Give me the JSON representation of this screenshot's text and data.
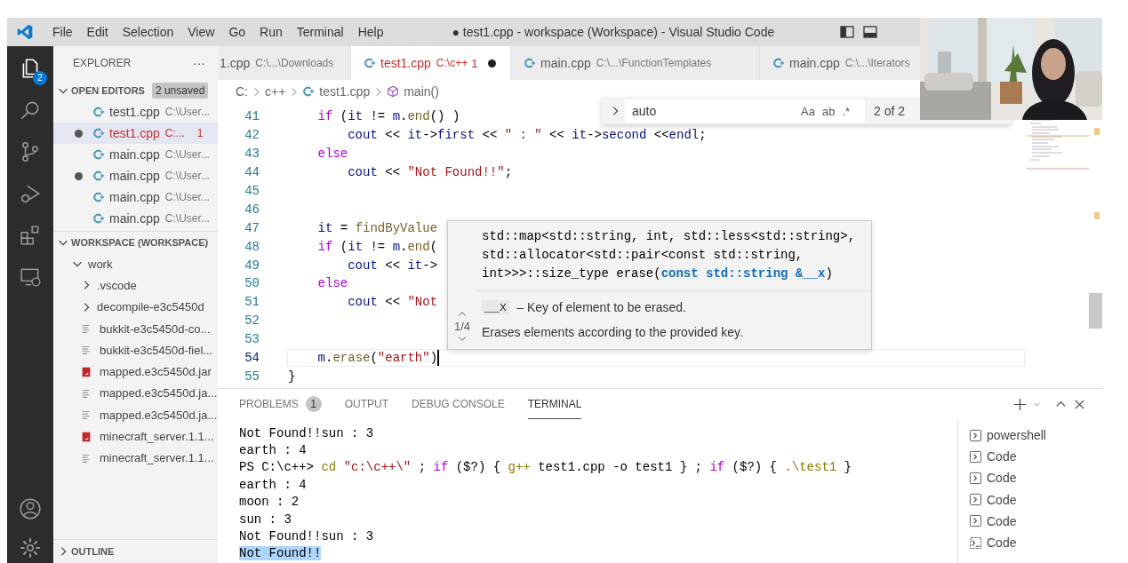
{
  "title_bar": {
    "menu": [
      "File",
      "Edit",
      "Selection",
      "View",
      "Go",
      "Run",
      "Terminal",
      "Help"
    ],
    "title": "● test1.cpp - workspace (Workspace) - Visual Studio Code"
  },
  "activity_bar": {
    "explorer_badge": "2"
  },
  "sidebar": {
    "title": "EXPLORER",
    "more": "···",
    "open_editors": {
      "label": "OPEN EDITORS",
      "badge": "2 unsaved",
      "items": [
        {
          "name": "test1.cpp",
          "path": "C:\\User...",
          "dirty": false,
          "selected": false,
          "error": false
        },
        {
          "name": "test1.cpp",
          "path": "C:...",
          "problems": "1",
          "dirty": true,
          "selected": true,
          "error": true
        },
        {
          "name": "main.cpp",
          "path": "C:\\User...",
          "dirty": false,
          "selected": false,
          "error": false
        },
        {
          "name": "main.cpp",
          "path": "C:\\User...",
          "dirty": true,
          "selected": false,
          "error": false
        },
        {
          "name": "main.cpp",
          "path": "C:\\User...",
          "dirty": false,
          "selected": false,
          "error": false
        },
        {
          "name": "main.cpp",
          "path": "C:\\User...",
          "dirty": false,
          "selected": false,
          "error": false
        }
      ]
    },
    "workspace": {
      "label": "WORKSPACE (WORKSPACE)",
      "items": [
        {
          "name": "work",
          "kind": "folder",
          "expanded": true,
          "children": [
            {
              "name": ".vscode",
              "kind": "folder",
              "expanded": false
            },
            {
              "name": "decompile-e3c5450d",
              "kind": "folder",
              "expanded": false
            },
            {
              "name": "bukkit-e3c5450d-co...",
              "kind": "text"
            },
            {
              "name": "bukkit-e3c5450d-fiel...",
              "kind": "text"
            },
            {
              "name": "mapped.e3c5450d.jar",
              "kind": "jar"
            },
            {
              "name": "mapped.e3c5450d.ja...",
              "kind": "text"
            },
            {
              "name": "mapped.e3c5450d.ja...",
              "kind": "text"
            },
            {
              "name": "minecraft_server.1.1...",
              "kind": "jar"
            },
            {
              "name": "minecraft_server.1.1...",
              "kind": "text"
            }
          ]
        }
      ]
    },
    "outline": "OUTLINE"
  },
  "tabs": [
    {
      "name": "1.cpp",
      "path": "C:\\...\\Downloads",
      "has_icon": false,
      "dirty": false,
      "error": false,
      "selected": false
    },
    {
      "name": "test1.cpp",
      "path": "C:\\c++",
      "problems": "1",
      "has_icon": true,
      "dirty": true,
      "error": true,
      "selected": true
    },
    {
      "name": "main.cpp",
      "path": "C:\\...\\FunctionTemplates",
      "has_icon": true,
      "dirty": false,
      "error": false,
      "selected": false
    },
    {
      "name": "main.cpp",
      "path": "C:\\...\\Iterators",
      "has_icon": true,
      "dirty": false,
      "error": false,
      "selected": false
    }
  ],
  "breadcrumb": [
    {
      "text": "C:",
      "kind": "folder"
    },
    {
      "text": "c++",
      "kind": "folder"
    },
    {
      "text": "test1.cpp",
      "kind": "file"
    },
    {
      "text": "main()",
      "kind": "symbol"
    }
  ],
  "code_lines": [
    {
      "number": "41",
      "current": false,
      "tokens": [
        {
          "text": "    if",
          "kind": "keyword"
        },
        {
          "text": " (",
          "kind": "plain"
        },
        {
          "text": "it",
          "kind": "variable"
        },
        {
          "text": " != ",
          "kind": "plain"
        },
        {
          "text": "m",
          "kind": "variable"
        },
        {
          "text": ".",
          "kind": "plain"
        },
        {
          "text": "end",
          "kind": "function"
        },
        {
          "text": "() )",
          "kind": "plain"
        }
      ]
    },
    {
      "number": "42",
      "current": false,
      "tokens": [
        {
          "text": "        cout",
          "kind": "variable"
        },
        {
          "text": " << ",
          "kind": "plain"
        },
        {
          "text": "it",
          "kind": "variable"
        },
        {
          "text": "->",
          "kind": "plain"
        },
        {
          "text": "first",
          "kind": "variable"
        },
        {
          "text": " << ",
          "kind": "plain"
        },
        {
          "text": "\" : \"",
          "kind": "string"
        },
        {
          "text": " << ",
          "kind": "plain"
        },
        {
          "text": "it",
          "kind": "variable"
        },
        {
          "text": "->",
          "kind": "plain"
        },
        {
          "text": "second",
          "kind": "variable"
        },
        {
          "text": " <<",
          "kind": "plain"
        },
        {
          "text": "endl",
          "kind": "variable"
        },
        {
          "text": ";",
          "kind": "plain"
        }
      ]
    },
    {
      "number": "43",
      "current": false,
      "tokens": [
        {
          "text": "    else",
          "kind": "keyword"
        }
      ]
    },
    {
      "number": "44",
      "current": false,
      "tokens": [
        {
          "text": "        cout",
          "kind": "variable"
        },
        {
          "text": " << ",
          "kind": "plain"
        },
        {
          "text": "\"Not Found!!\"",
          "kind": "string"
        },
        {
          "text": ";",
          "kind": "plain"
        }
      ]
    },
    {
      "number": "45",
      "current": false
    },
    {
      "number": "46",
      "current": false
    },
    {
      "number": "47",
      "current": false,
      "tokens": [
        {
          "text": "    it",
          "kind": "variable"
        },
        {
          "text": " = ",
          "kind": "plain"
        },
        {
          "text": "findByValue",
          "kind": "function"
        }
      ]
    },
    {
      "number": "48",
      "current": false,
      "tokens": [
        {
          "text": "    if",
          "kind": "keyword"
        },
        {
          "text": " (",
          "kind": "plain"
        },
        {
          "text": "it",
          "kind": "variable"
        },
        {
          "text": " != ",
          "kind": "plain"
        },
        {
          "text": "m",
          "kind": "variable"
        },
        {
          "text": ".",
          "kind": "plain"
        },
        {
          "text": "end",
          "kind": "function"
        },
        {
          "text": "(",
          "kind": "plain"
        }
      ]
    },
    {
      "number": "49",
      "current": false,
      "tokens": [
        {
          "text": "        cout",
          "kind": "variable"
        },
        {
          "text": " << ",
          "kind": "plain"
        },
        {
          "text": "it",
          "kind": "variable"
        },
        {
          "text": "->",
          "kind": "plain"
        }
      ]
    },
    {
      "number": "50",
      "current": false,
      "tokens": [
        {
          "text": "    else",
          "kind": "keyword"
        }
      ]
    },
    {
      "number": "51",
      "current": false,
      "tokens": [
        {
          "text": "        cout",
          "kind": "variable"
        },
        {
          "text": " << ",
          "kind": "plain"
        },
        {
          "text": "\"Not",
          "kind": "string"
        }
      ]
    },
    {
      "number": "52",
      "current": false
    },
    {
      "number": "53",
      "current": false
    },
    {
      "number": "54",
      "current": true,
      "tokens": [
        {
          "text": "    m",
          "kind": "variable"
        },
        {
          "text": ".",
          "kind": "plain"
        },
        {
          "text": "erase",
          "kind": "function"
        },
        {
          "text": "(",
          "kind": "plain"
        },
        {
          "text": "\"earth\"",
          "kind": "string"
        },
        {
          "text": ")",
          "kind": "plain"
        }
      ]
    },
    {
      "number": "55",
      "current": false,
      "tokens": [
        {
          "text": "}",
          "kind": "plain"
        }
      ]
    }
  ],
  "find_widget": {
    "value": "auto",
    "options": [
      "Aa",
      "ab",
      ".*"
    ],
    "result": "2 of 2"
  },
  "hover": {
    "counter": "1/4",
    "signature": [
      [
        {
          "text": "std::map<std::string, int, std::less<std::string>,",
          "kind": "plain"
        }
      ],
      [
        {
          "text": "std::allocator<std::pair<const std::string,",
          "kind": "plain"
        }
      ],
      [
        {
          "text": "int>>>::size_type erase(",
          "kind": "plain"
        },
        {
          "text": "const std::string &__x",
          "kind": "param"
        },
        {
          "text": ")",
          "kind": "plain"
        }
      ]
    ],
    "param": "__x",
    "param_doc": "– Key of element to be erased.",
    "description": "Erases elements according to the provided key."
  },
  "panel": {
    "tabs": [
      {
        "label": "PROBLEMS",
        "badge": "1",
        "selected": false
      },
      {
        "label": "OUTPUT",
        "selected": false
      },
      {
        "label": "DEBUG CONSOLE",
        "selected": false
      },
      {
        "label": "TERMINAL",
        "selected": true
      }
    ],
    "terminal_lines": [
      {
        "selected": false,
        "tokens": [
          {
            "text": "Not Found!!sun : 3",
            "kind": "plain"
          }
        ]
      },
      {
        "selected": false,
        "tokens": [
          {
            "text": "earth : 4",
            "kind": "plain"
          }
        ]
      },
      {
        "selected": false,
        "tokens": [
          {
            "text": "PS C:\\c++> ",
            "kind": "plain"
          },
          {
            "text": "cd ",
            "kind": "command"
          },
          {
            "text": "\"c:\\c++\\\"",
            "kind": "string"
          },
          {
            "text": " ; ",
            "kind": "plain"
          },
          {
            "text": "if",
            "kind": "keyword"
          },
          {
            "text": " ($?) { ",
            "kind": "plain"
          },
          {
            "text": "g++",
            "kind": "command"
          },
          {
            "text": " test1.cpp -o test1 } ; ",
            "kind": "plain"
          },
          {
            "text": "if",
            "kind": "keyword"
          },
          {
            "text": " ($?) { ",
            "kind": "plain"
          },
          {
            "text": ".\\test1",
            "kind": "command"
          },
          {
            "text": " }",
            "kind": "plain"
          }
        ]
      },
      {
        "selected": false,
        "tokens": [
          {
            "text": "earth : 4",
            "kind": "plain"
          }
        ]
      },
      {
        "selected": false,
        "tokens": [
          {
            "text": "moon : 2",
            "kind": "plain"
          }
        ]
      },
      {
        "selected": false,
        "tokens": [
          {
            "text": "sun : 3",
            "kind": "plain"
          }
        ]
      },
      {
        "selected": false,
        "tokens": [
          {
            "text": "Not Found!!sun : 3",
            "kind": "plain"
          }
        ]
      },
      {
        "selected": true,
        "tokens": [
          {
            "text": "Not Found!!",
            "kind": "plain"
          }
        ]
      }
    ],
    "terminals": [
      {
        "name": "powershell",
        "kind": "shell"
      },
      {
        "name": "Code",
        "kind": "shell"
      },
      {
        "name": "Code",
        "kind": "shell"
      },
      {
        "name": "Code",
        "kind": "shell"
      },
      {
        "name": "Code",
        "kind": "shell"
      },
      {
        "name": "Code",
        "kind": "task"
      }
    ]
  }
}
